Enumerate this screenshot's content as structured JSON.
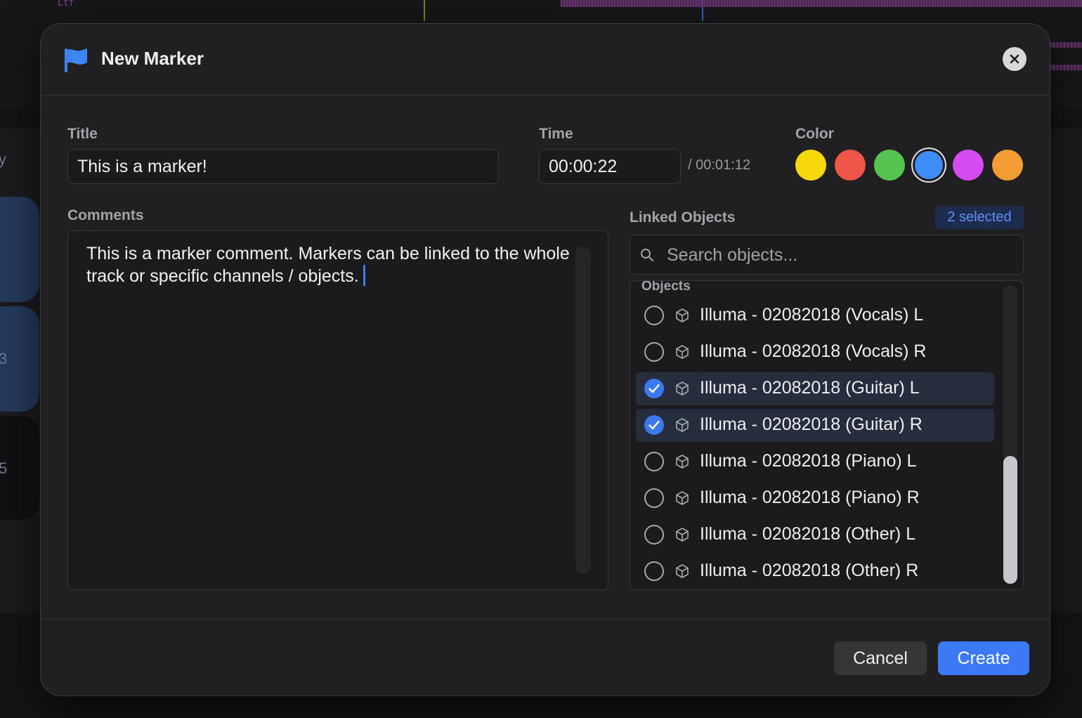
{
  "background": {
    "top_text": "Ltf",
    "side_letters": [
      "y",
      "3",
      "5"
    ]
  },
  "dialog": {
    "title": "New Marker",
    "flag_icon": "flag-icon",
    "close_icon": "close-icon"
  },
  "fields": {
    "title_label": "Title",
    "title_value": "This is a marker!",
    "time_label": "Time",
    "time_value": "00:00:22",
    "time_total": "/ 00:01:12",
    "color_label": "Color",
    "colors": [
      "#f7d80a",
      "#ef5548",
      "#56c451",
      "#3f8ef7",
      "#d64af2",
      "#f39c33"
    ],
    "selected_color_index": 3
  },
  "comments": {
    "label": "Comments",
    "text": "This is a marker comment. Markers can be linked to the whole track or specific channels / objects."
  },
  "linked_objects": {
    "label": "Linked Objects",
    "badge": "2 selected",
    "search_placeholder": "Search objects...",
    "section_heading": "Objects",
    "items": [
      {
        "label": "Illuma - 02082018 (Vocals) L",
        "checked": false
      },
      {
        "label": "Illuma - 02082018 (Vocals) R",
        "checked": false
      },
      {
        "label": "Illuma - 02082018 (Guitar) L",
        "checked": true
      },
      {
        "label": "Illuma - 02082018 (Guitar) R",
        "checked": true
      },
      {
        "label": "Illuma - 02082018 (Piano) L",
        "checked": false
      },
      {
        "label": "Illuma - 02082018 (Piano) R",
        "checked": false
      },
      {
        "label": "Illuma - 02082018 (Other) L",
        "checked": false
      },
      {
        "label": "Illuma - 02082018 (Other) R",
        "checked": false
      }
    ]
  },
  "footer": {
    "cancel_label": "Cancel",
    "create_label": "Create"
  }
}
